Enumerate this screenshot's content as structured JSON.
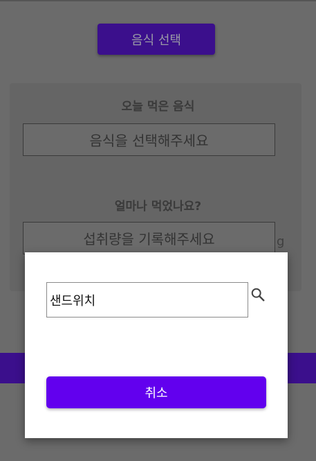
{
  "header": {
    "select_food_label": "음식 선택"
  },
  "form": {
    "food_label": "오늘 먹은 음식",
    "food_placeholder": "음식을 선택해주세요",
    "amount_label": "얼마나 먹었나요?",
    "amount_placeholder": "섭취량을 기록해주세요",
    "amount_unit": "g"
  },
  "dialog": {
    "search_value": "샌드위치",
    "cancel_label": "취소"
  },
  "colors": {
    "primary": "#6200ee",
    "primary_dimmed": "#3b0f8c",
    "overlay": "#6b6b6b"
  }
}
